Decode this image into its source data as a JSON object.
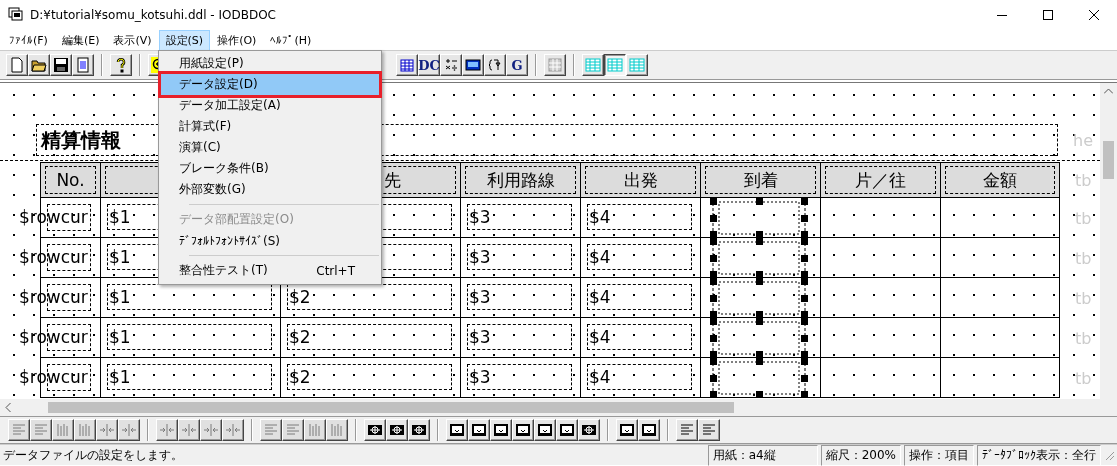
{
  "window": {
    "title": "D:¥tutorial¥somu_kotsuhi.ddl - IODBDOC"
  },
  "menu_bar": [
    {
      "label": "ﾌｧｲﾙ(F)",
      "selected": false
    },
    {
      "label": "編集(E)",
      "selected": false
    },
    {
      "label": "表示(V)",
      "selected": false
    },
    {
      "label": "設定(S)",
      "selected": true
    },
    {
      "label": "操作(O)",
      "selected": false
    },
    {
      "label": "ﾍﾙﾌﾟ(H)",
      "selected": false
    }
  ],
  "toolbar": [
    {
      "kind": "new"
    },
    {
      "kind": "open"
    },
    {
      "kind": "save"
    },
    {
      "kind": "page"
    },
    {
      "kind": "sep"
    },
    {
      "kind": "help"
    },
    {
      "kind": "sep"
    },
    {
      "kind": "zoom"
    },
    {
      "kind": "gap"
    },
    {
      "kind": "grid"
    },
    {
      "kind": "text",
      "label": "DC"
    },
    {
      "kind": "calc"
    },
    {
      "kind": "screen"
    },
    {
      "kind": "brace"
    },
    {
      "kind": "text",
      "label": "G"
    },
    {
      "kind": "sep"
    },
    {
      "kind": "blocks"
    },
    {
      "kind": "sep"
    },
    {
      "kind": "table",
      "selected": false
    },
    {
      "kind": "table",
      "selected": true
    },
    {
      "kind": "table",
      "selected": false
    }
  ],
  "report": {
    "title": "精算情報",
    "title_side_label": "he",
    "columns": [
      {
        "label": "No."
      },
      {
        "label": "先"
      },
      {
        "label": "利用路線"
      },
      {
        "label": "出発"
      },
      {
        "label": "到着"
      },
      {
        "label": "片／往"
      },
      {
        "label": "金額"
      }
    ],
    "header_side_label": "tb",
    "rows": [
      {
        "no": "$rowcur",
        "c1": "$1",
        "c3": "$3",
        "c4": "$4",
        "c5_selected": true,
        "side_label": "tb"
      },
      {
        "no": "$rowcur",
        "c1": "$1",
        "c3": "$3",
        "c4": "$4",
        "c5_selected": true,
        "side_label": "tb"
      },
      {
        "no": "$rowcur",
        "c1": "$1",
        "c2": "$2",
        "c3": "$3",
        "c4": "$4",
        "c5_selected": true,
        "side_label": "tb"
      },
      {
        "no": "$rowcur",
        "c1": "$1",
        "c2": "$2",
        "c3": "$3",
        "c4": "$4",
        "c5_selected": true,
        "side_label": "tb"
      },
      {
        "no": "$rowcur",
        "c1": "$1",
        "c2": "$2",
        "c3": "$3",
        "c4": "$4",
        "c5_selected": true,
        "side_label": "tb"
      }
    ]
  },
  "dropdown_menu": [
    {
      "kind": "item",
      "label": "用紙設定(P)",
      "selected": false,
      "disabled": false
    },
    {
      "kind": "item",
      "label": "データ設定(D)",
      "selected": true,
      "disabled": false
    },
    {
      "kind": "item",
      "label": "データ加工設定(A)",
      "selected": false,
      "disabled": false
    },
    {
      "kind": "item",
      "label": "計算式(F)",
      "selected": false,
      "disabled": false
    },
    {
      "kind": "item",
      "label": "演算(C)",
      "selected": false,
      "disabled": false
    },
    {
      "kind": "item",
      "label": "ブレーク条件(B)",
      "selected": false,
      "disabled": false
    },
    {
      "kind": "item",
      "label": "外部変数(G)",
      "selected": false,
      "disabled": false
    },
    {
      "kind": "separator"
    },
    {
      "kind": "item",
      "label": "データ部配置設定(O)",
      "selected": false,
      "disabled": true
    },
    {
      "kind": "item",
      "label": "ﾃﾞﾌｫﾙﾄﾌｫﾝﾄｻｲｽﾞ(S)",
      "selected": false,
      "disabled": false
    },
    {
      "kind": "separator"
    },
    {
      "kind": "item",
      "label": "整合性テスト(T)",
      "shortcut": "Ctrl+T",
      "selected": false,
      "disabled": false
    }
  ],
  "bottom_toolbar": [
    [
      {
        "kind": "lines",
        "disabled": true
      },
      {
        "kind": "lines",
        "disabled": true
      },
      {
        "kind": "bars",
        "disabled": true
      },
      {
        "kind": "bars",
        "disabled": true
      },
      {
        "kind": "arrows",
        "disabled": true
      },
      {
        "kind": "arrows",
        "disabled": true
      }
    ],
    [
      {
        "kind": "arrows",
        "disabled": true
      },
      {
        "kind": "arrows",
        "disabled": true
      },
      {
        "kind": "arrows",
        "disabled": true
      },
      {
        "kind": "arrows",
        "disabled": true
      }
    ],
    [
      {
        "kind": "lines",
        "disabled": true
      },
      {
        "kind": "lines",
        "disabled": true
      },
      {
        "kind": "bars",
        "disabled": true
      },
      {
        "kind": "bars",
        "disabled": true
      }
    ],
    [
      {
        "kind": "cross",
        "disabled": false
      },
      {
        "kind": "cross",
        "disabled": false
      },
      {
        "kind": "cross",
        "disabled": false
      }
    ],
    [
      {
        "kind": "frame",
        "disabled": false
      },
      {
        "kind": "frame",
        "disabled": false
      },
      {
        "kind": "frame",
        "disabled": false
      },
      {
        "kind": "frame",
        "disabled": false
      },
      {
        "kind": "frame",
        "disabled": false
      },
      {
        "kind": "frame",
        "disabled": false
      },
      {
        "kind": "cross",
        "disabled": false
      }
    ],
    [
      {
        "kind": "frame",
        "disabled": false
      },
      {
        "kind": "frame",
        "disabled": false
      }
    ],
    [
      {
        "kind": "lines",
        "disabled": false
      },
      {
        "kind": "lines",
        "disabled": false
      }
    ]
  ],
  "status_bar": {
    "message": "データファイルの設定をします。",
    "panes": [
      "用紙：a4縦",
      "縮尺：200%",
      "操作：項目",
      "ﾃﾞｰﾀﾌﾞﾛｯｸ表示：全行"
    ]
  }
}
